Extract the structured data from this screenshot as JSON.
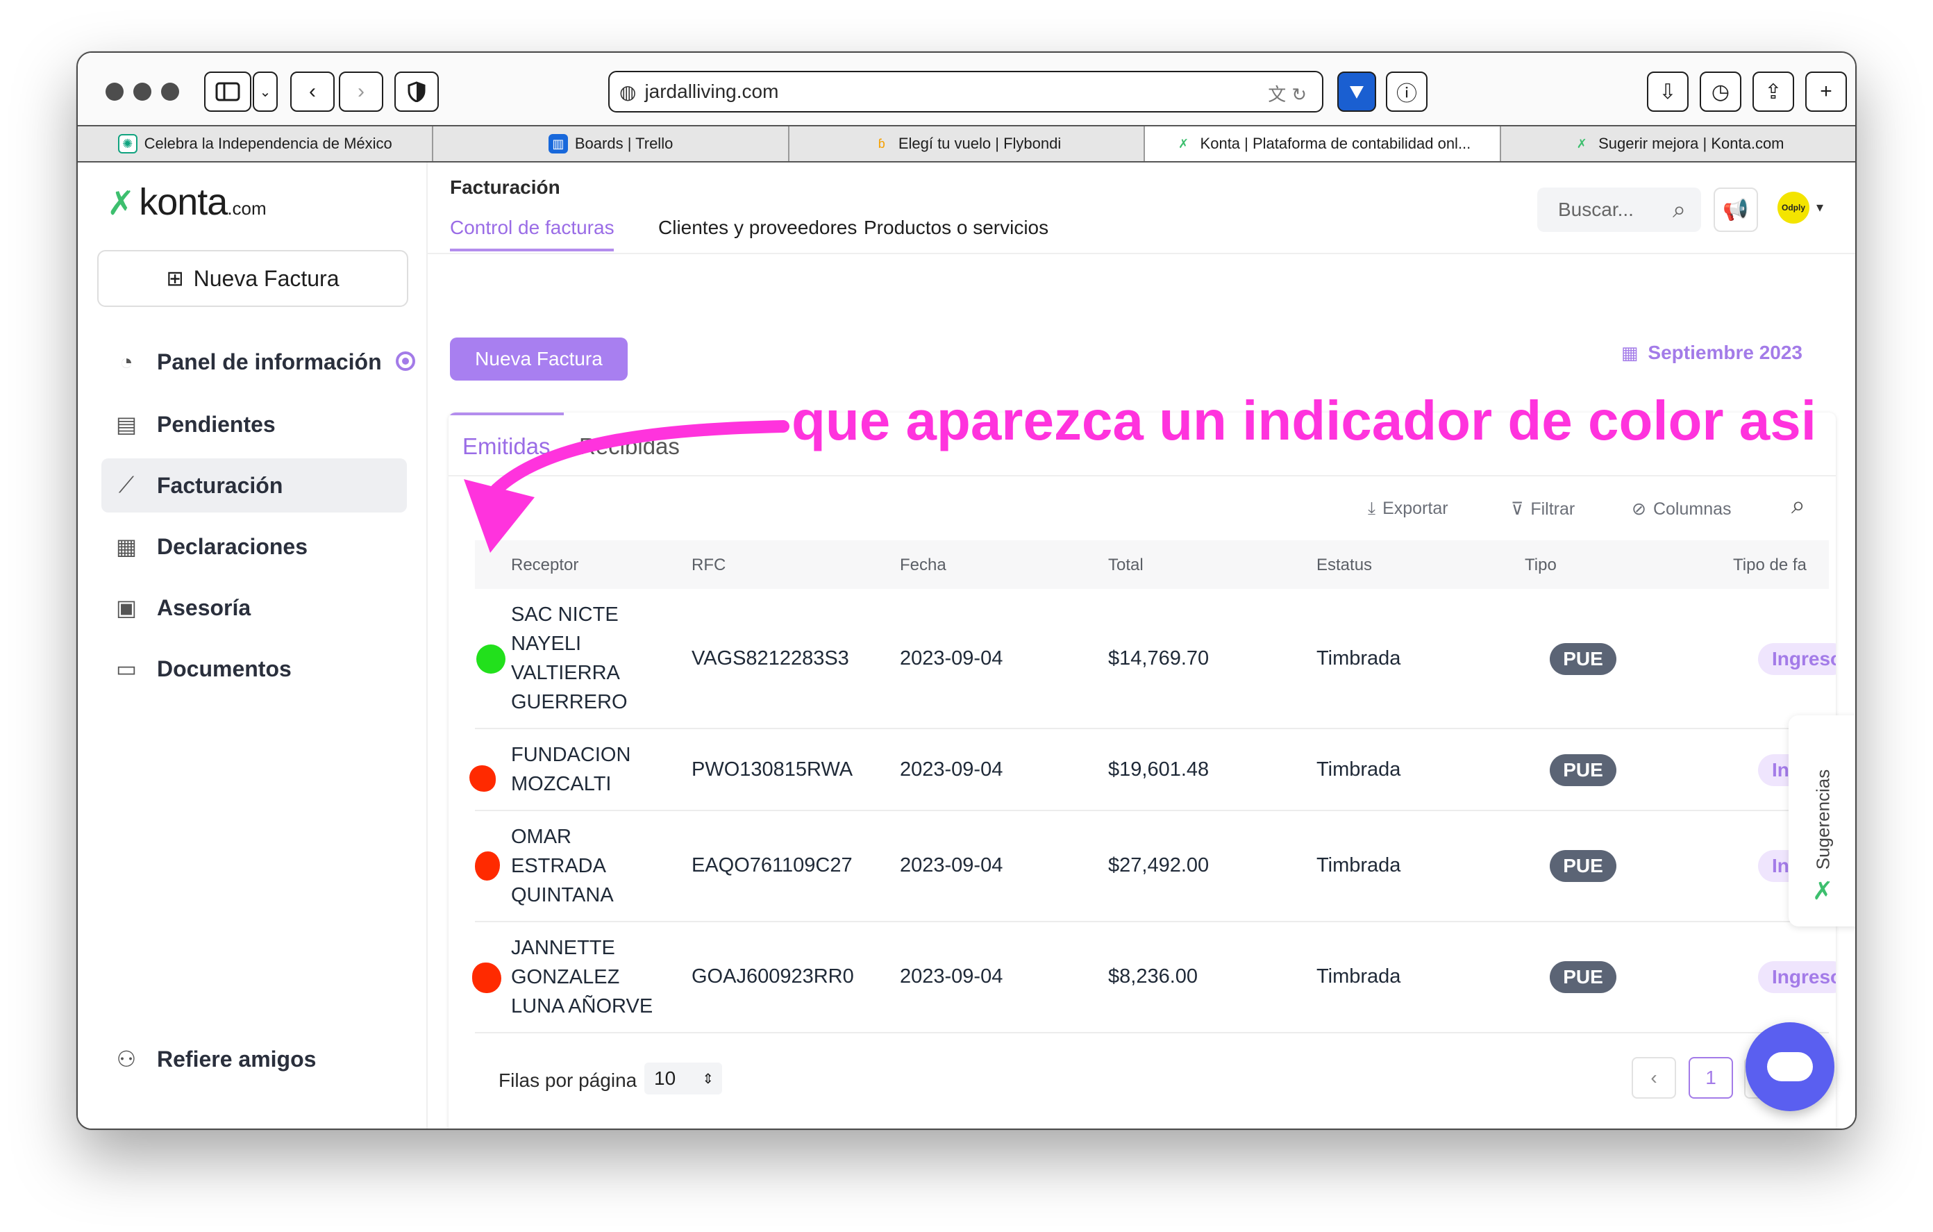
{
  "browser": {
    "url": "jardalliving.com",
    "tabs": [
      {
        "label": "Celebra la Independencia de México",
        "icon": "openai-icon",
        "active": false
      },
      {
        "label": "Boards | Trello",
        "icon": "trello-icon",
        "active": false
      },
      {
        "label": "Elegí tu vuelo | Flybondi",
        "icon": "flybondi-icon",
        "active": false
      },
      {
        "label": "Konta | Plataforma de contabilidad onl...",
        "icon": "konta-icon",
        "active": true
      },
      {
        "label": "Sugerir mejora | Konta.com",
        "icon": "konta-icon",
        "active": false
      }
    ]
  },
  "sidebar": {
    "logo_text": "konta",
    "logo_suffix": ".com",
    "new_invoice": "Nueva Factura",
    "items": [
      {
        "label": "Panel de información",
        "icon": "dashboard-gauge-icon"
      },
      {
        "label": "Pendientes",
        "icon": "document-list-icon"
      },
      {
        "label": "Facturación",
        "icon": "trend-chart-icon"
      },
      {
        "label": "Declaraciones",
        "icon": "calendar-icon"
      },
      {
        "label": "Asesoría",
        "icon": "calendar-check-icon"
      },
      {
        "label": "Documentos",
        "icon": "folder-icon"
      }
    ],
    "referral": "Refiere amigos"
  },
  "header": {
    "title": "Facturación",
    "subtabs": [
      "Control de facturas",
      "Clientes y proveedores",
      "Productos o servicios"
    ],
    "search_placeholder": "Buscar...",
    "avatar_text": "Odply"
  },
  "main": {
    "new_invoice": "Nueva Factura",
    "period": "Septiembre 2023",
    "tabs": [
      "Emitidas",
      "Recibidas"
    ],
    "tools": {
      "export": "Exportar",
      "filter": "Filtrar",
      "columns": "Columnas"
    },
    "columns": [
      "Receptor",
      "RFC",
      "Fecha",
      "Total",
      "Estatus",
      "Tipo",
      "Tipo de fa"
    ],
    "rows": [
      {
        "receptor": [
          "SAC NICTE",
          "NAYELI",
          "VALTIERRA",
          "GUERRERO"
        ],
        "rfc": "VAGS8212283S3",
        "fecha": "2023-09-04",
        "total": "$14,769.70",
        "estatus": "Timbrada",
        "tipo": "PUE",
        "tipo_factura": "Ingreso",
        "indicator": "#22e01c"
      },
      {
        "receptor": [
          "FUNDACION",
          "MOZCALTI"
        ],
        "rfc": "PWO130815RWA",
        "fecha": "2023-09-04",
        "total": "$19,601.48",
        "estatus": "Timbrada",
        "tipo": "PUE",
        "tipo_factura": "Ingreso",
        "indicator": "#ff2a00"
      },
      {
        "receptor": [
          "OMAR",
          "ESTRADA",
          "QUINTANA"
        ],
        "rfc": "EAQO761109C27",
        "fecha": "2023-09-04",
        "total": "$27,492.00",
        "estatus": "Timbrada",
        "tipo": "PUE",
        "tipo_factura": "Ingreso",
        "indicator": "#ff2a00"
      },
      {
        "receptor": [
          "JANNETTE",
          "GONZALEZ",
          "LUNA AÑORVE"
        ],
        "rfc": "GOAJ600923RR0",
        "fecha": "2023-09-04",
        "total": "$8,236.00",
        "estatus": "Timbrada",
        "tipo": "PUE",
        "tipo_factura": "Ingreso",
        "indicator": "#ff2a00"
      }
    ],
    "rows_per_page_label": "Filas por página",
    "rows_per_page": "10",
    "current_page": "1"
  },
  "suggestions_tab": "Sugerencias",
  "annotation": {
    "text": "que aparezca un indicador de color asi",
    "color": "#ff33dd"
  },
  "colors": {
    "accent": "#a37be8",
    "brand_green": "#3dbf6e",
    "chat": "#5a5ff0"
  }
}
